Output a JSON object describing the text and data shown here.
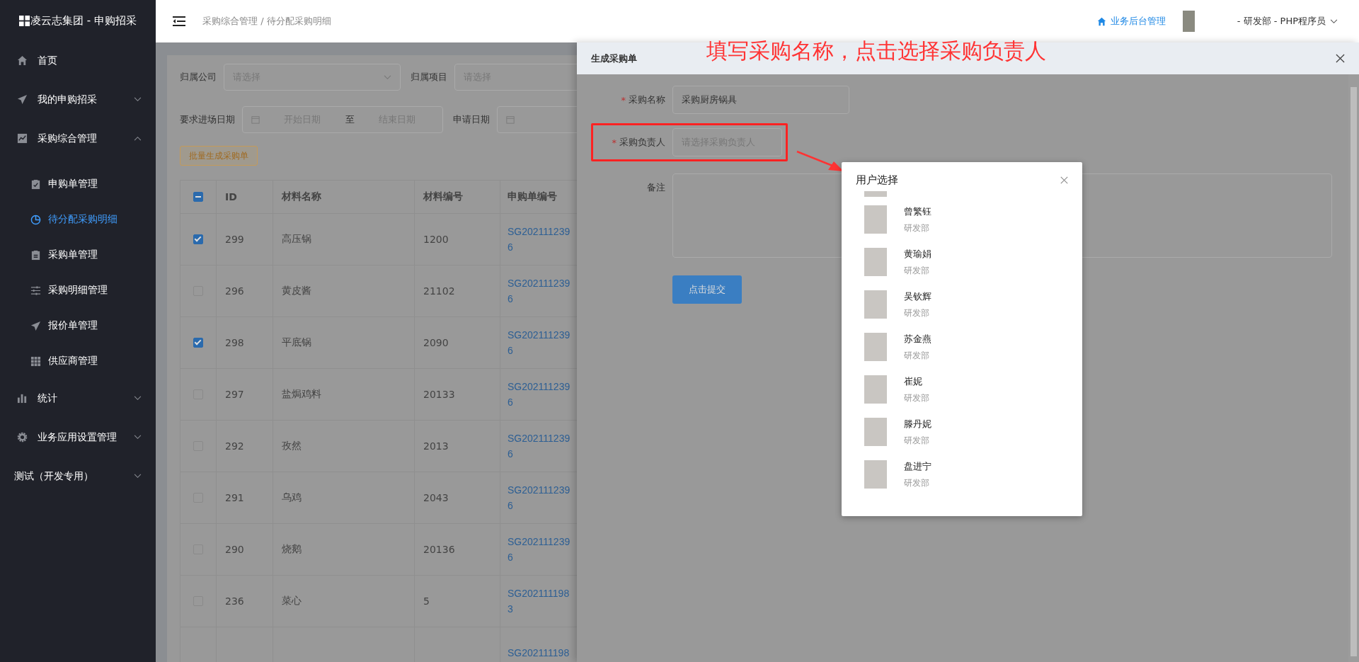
{
  "sidebar": {
    "logo": "凌云志集团 - 申购招采",
    "items": [
      {
        "label": "首页",
        "kind": "link",
        "selected": false
      },
      {
        "label": "我的申购招采",
        "kind": "submenu",
        "expanded": false,
        "selected": false
      },
      {
        "label": "采购综合管理",
        "kind": "submenu",
        "expanded": true,
        "selected": false,
        "children": [
          {
            "label": "申购单管理",
            "selected": false
          },
          {
            "label": "待分配采购明细",
            "selected": true
          },
          {
            "label": "采购单管理",
            "selected": false
          },
          {
            "label": "采购明细管理",
            "selected": false
          },
          {
            "label": "报价单管理",
            "selected": false
          },
          {
            "label": "供应商管理",
            "selected": false
          }
        ]
      },
      {
        "label": "统计",
        "kind": "submenu",
        "expanded": false,
        "selected": false
      },
      {
        "label": "业务应用设置管理",
        "kind": "submenu",
        "expanded": false,
        "selected": false
      },
      {
        "label": "测试（开发专用）",
        "kind": "submenu",
        "expanded": false,
        "selected": false
      }
    ]
  },
  "header": {
    "breadcrumb": "采购综合管理 / 待分配采购明细",
    "admin_link": "业务后台管理",
    "user_role": "- 研发部 - PHP程序员"
  },
  "filters": [
    [
      {
        "label": "归属公司",
        "kind": "select",
        "placeholder": "请选择"
      },
      {
        "label": "归属项目",
        "kind": "input",
        "placeholder": "请选择"
      }
    ],
    [
      {
        "label": "要求进场日期",
        "kind": "daterange",
        "start_placeholder": "开始日期",
        "separator": "至",
        "end_placeholder": "结束日期"
      },
      {
        "label": "申请日期",
        "kind": "date"
      }
    ]
  ],
  "batch_button": "批量生成采购单",
  "table": {
    "select_all": {
      "indeterminate": true
    },
    "columns": [
      "ID",
      "材料名称",
      "材料编号",
      "申购单编号"
    ],
    "rows": [
      {
        "checked": true,
        "id": "299",
        "name": "高压锅",
        "code": "1200",
        "order": "SG2021112396"
      },
      {
        "checked": false,
        "id": "296",
        "name": "黄皮酱",
        "code": "21102",
        "order": "SG2021112396"
      },
      {
        "checked": true,
        "id": "298",
        "name": "平底锅",
        "code": "2090",
        "order": "SG2021112396"
      },
      {
        "checked": false,
        "id": "297",
        "name": "盐焗鸡料",
        "code": "20133",
        "order": "SG2021112396"
      },
      {
        "checked": false,
        "id": "292",
        "name": "孜然",
        "code": "2013",
        "order": "SG2021112396"
      },
      {
        "checked": false,
        "id": "291",
        "name": "乌鸡",
        "code": "2043",
        "order": "SG2021112396"
      },
      {
        "checked": false,
        "id": "290",
        "name": "烧鹅",
        "code": "20136",
        "order": "SG2021112396"
      },
      {
        "checked": false,
        "id": "236",
        "name": "菜心",
        "code": "5",
        "order": "SG2021111983"
      },
      {
        "order": "SG202111198"
      }
    ]
  },
  "drawer": {
    "title": "生成采购单",
    "required_mark": "*",
    "fields": [
      {
        "label": "采购名称",
        "required": true,
        "kind": "input",
        "value": "采购厨房锅具",
        "highlighted": false
      },
      {
        "label": "采购负责人",
        "required": true,
        "kind": "input",
        "placeholder": "请选择采购负责人",
        "highlighted": true
      },
      {
        "label": "备注",
        "required": false,
        "kind": "textarea",
        "highlighted": false
      }
    ],
    "submit": "点击提交"
  },
  "annotation": {
    "text": "填写采购名称，点击选择采购负责人"
  },
  "user_dialog": {
    "title": "用户选择",
    "users": [
      {
        "name": "曾繁钰",
        "dept": "研发部"
      },
      {
        "name": "黄瑜娟",
        "dept": "研发部"
      },
      {
        "name": "吴钦辉",
        "dept": "研发部"
      },
      {
        "name": "苏金燕",
        "dept": "研发部"
      },
      {
        "name": "崔妮",
        "dept": "研发部"
      },
      {
        "name": "滕丹妮",
        "dept": "研发部"
      },
      {
        "name": "盘进宁",
        "dept": "研发部"
      }
    ]
  }
}
